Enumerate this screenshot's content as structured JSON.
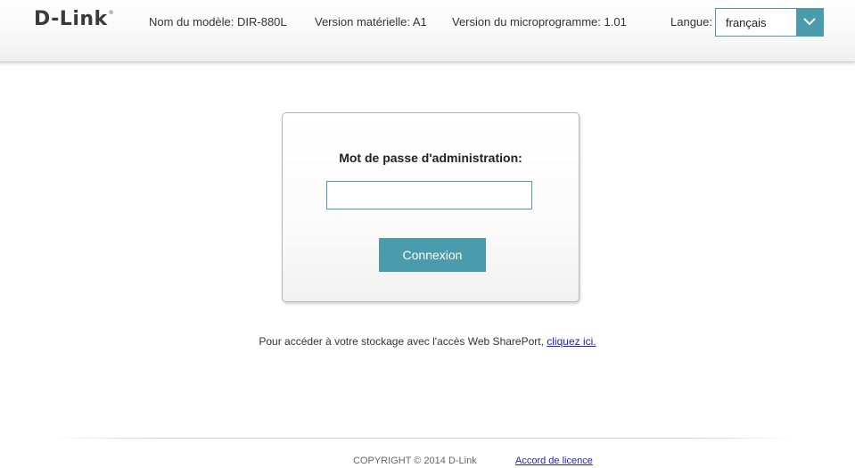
{
  "header": {
    "logo_text": "D-Link",
    "logo_mark": "®",
    "model": "Nom du modèle: DIR-880L",
    "hardware_version": "Version matérielle: A1",
    "firmware_version": "Version du microprogramme: 1.01",
    "language_label": "Langue:",
    "language_selected": "français"
  },
  "login": {
    "password_label": "Mot de passe d'administration:",
    "password_value": "",
    "login_button": "Connexion"
  },
  "shareport": {
    "text": "Pour accéder à votre stockage avec l'accès Web SharePort, ",
    "link": "cliquez ici."
  },
  "footer": {
    "copyright": "COPYRIGHT © 2014 D-Link",
    "license_link": "Accord de licence"
  },
  "colors": {
    "accent": "#4a9bab",
    "link": "#1f1fbf"
  },
  "icons": {
    "dropdown": "chevron-down-icon"
  }
}
